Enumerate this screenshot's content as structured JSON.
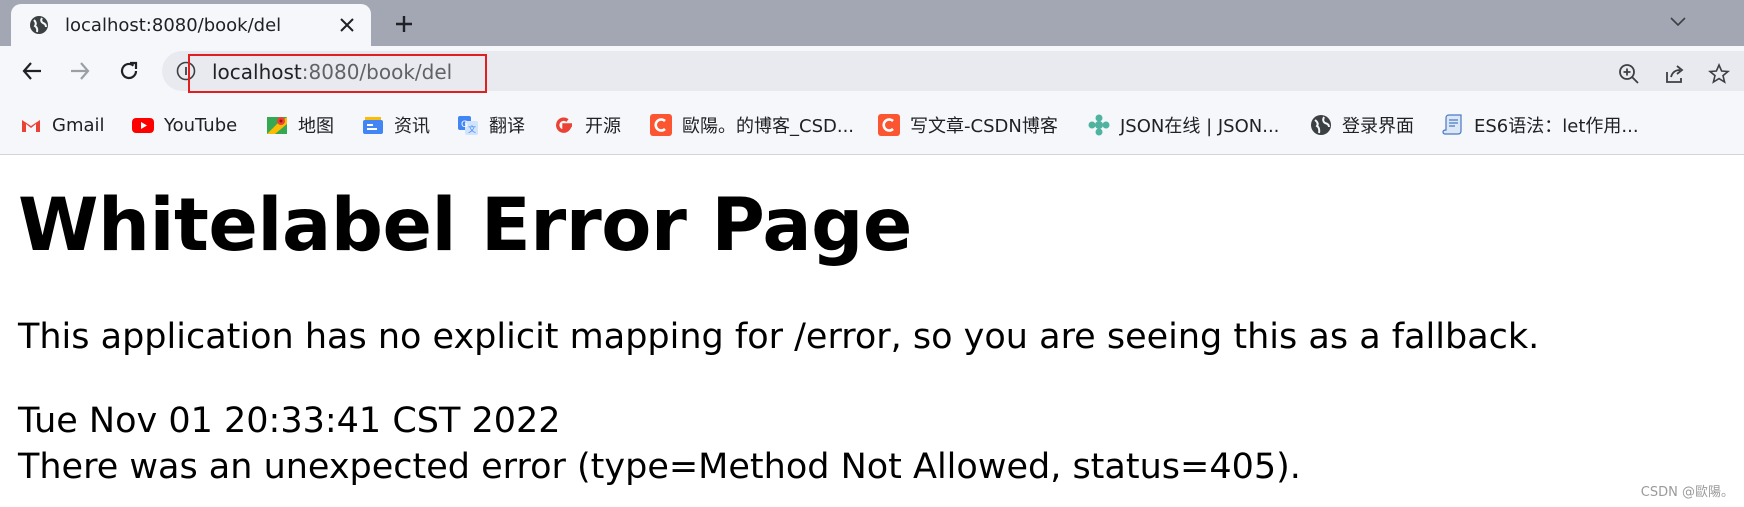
{
  "tab": {
    "title": "localhost:8080/book/del",
    "favicon": "globe-icon",
    "close_icon": "close-icon"
  },
  "tabstrip": {
    "new_tab_icon": "plus-icon",
    "tab_search_icon": "chevron-down-icon"
  },
  "toolbar": {
    "back_icon": "arrow-left-icon",
    "forward_icon": "arrow-right-icon",
    "reload_icon": "reload-icon",
    "site_info_icon": "info-icon",
    "url_host": "localhost",
    "url_rest": ":8080/book/del",
    "zoom_icon": "zoom-in-icon",
    "share_icon": "share-icon",
    "bookmark_star_icon": "star-icon",
    "highlight_color": "#e02020"
  },
  "bookmarks": [
    {
      "label": "Gmail",
      "icon": "gmail-icon"
    },
    {
      "label": "YouTube",
      "icon": "youtube-icon"
    },
    {
      "label": "地图",
      "icon": "maps-icon"
    },
    {
      "label": "资讯",
      "icon": "news-icon"
    },
    {
      "label": "翻译",
      "icon": "translate-icon"
    },
    {
      "label": "开源",
      "icon": "google-icon"
    },
    {
      "label": "歐陽。的博客_CSD...",
      "icon": "csdn-icon"
    },
    {
      "label": "写文章-CSDN博客",
      "icon": "csdn-icon"
    },
    {
      "label": "JSON在线 | JSON...",
      "icon": "json-icon"
    },
    {
      "label": "登录界面",
      "icon": "globe-icon"
    },
    {
      "label": "ES6语法：let作用...",
      "icon": "document-icon"
    }
  ],
  "page": {
    "title": "Whitelabel Error Page",
    "message": "This application has no explicit mapping for /error, so you are seeing this as a fallback.",
    "timestamp": "Tue Nov 01 20:33:41 CST 2022",
    "error": "There was an unexpected error (type=Method Not Allowed, status=405)."
  },
  "watermark": "CSDN @歐陽。"
}
